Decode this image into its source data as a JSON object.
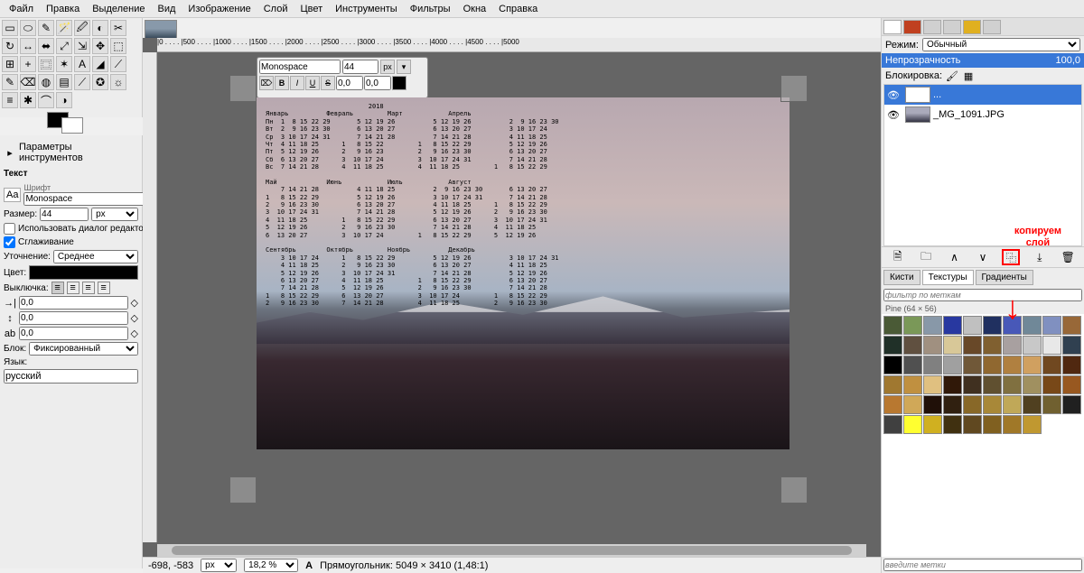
{
  "menu": [
    "Файл",
    "Правка",
    "Выделение",
    "Вид",
    "Изображение",
    "Слой",
    "Цвет",
    "Инструменты",
    "Фильтры",
    "Окна",
    "Справка"
  ],
  "tools": [
    "▭",
    "⬭",
    "✎",
    "🪄",
    "🖉",
    "◐",
    "✂",
    "↻",
    "↔",
    "⬌",
    "⤢",
    "⇲",
    "✥",
    "⬚",
    "⊞",
    "+",
    "⿴",
    "✶",
    "A",
    "◢",
    "⟋",
    "✎",
    "⌫",
    "◍",
    "▤",
    "⟋",
    "✪",
    "☼",
    "≡",
    "✱",
    "⌒",
    "◑"
  ],
  "tool_options": {
    "header": "Параметры инструментов",
    "section": "Текст",
    "font_label": "Шрифт",
    "font_value": "Monospace",
    "size_label": "Размер:",
    "size_value": "44",
    "size_unit": "px",
    "editor_dialog": "Использовать диалог редактора",
    "antialias": "Сглаживание",
    "hinting_label": "Уточнение:",
    "hinting_value": "Среднее",
    "color_label": "Цвет:",
    "justify_label": "Выключка:",
    "indent_value": "0,0",
    "line_value": "0,0",
    "letter_value": "0,0",
    "block_label": "Блок:",
    "block_value": "Фиксированный",
    "lang_label": "Язык:",
    "lang_value": "русский"
  },
  "text_toolbar": {
    "font": "Monospace",
    "size": "44",
    "unit": "px",
    "kern": "0,0",
    "baseline": "0,0"
  },
  "calendar_year": "2018",
  "cal_months": [
    {
      "name": "Январь",
      "rows": [
        "Пн  1  8 15 22 29",
        "Вт  2  9 16 23 30",
        "Ср  3 10 17 24 31",
        "Чт  4 11 18 25",
        "Пт  5 12 19 26",
        "Сб  6 13 20 27",
        "Вс  7 14 21 28"
      ]
    },
    {
      "name": "Февраль",
      "rows": [
        "    5 12 19 26",
        "    6 13 20 27",
        "    7 14 21 28",
        "1   8 15 22",
        "2   9 16 23",
        "3  10 17 24",
        "4  11 18 25"
      ]
    },
    {
      "name": "Март",
      "rows": [
        "    5 12 19 26",
        "    6 13 20 27",
        "    7 14 21 28",
        "1   8 15 22 29",
        "2   9 16 23 30",
        "3  10 17 24 31",
        "4  11 18 25"
      ]
    },
    {
      "name": "Апрель",
      "rows": [
        "    2  9 16 23 30",
        "    3 10 17 24",
        "    4 11 18 25",
        "    5 12 19 26",
        "    6 13 20 27",
        "    7 14 21 28",
        "1   8 15 22 29"
      ]
    },
    {
      "name": "Май",
      "rows": [
        "    7 14 21 28",
        "1   8 15 22 29",
        "2   9 16 23 30",
        "3  10 17 24 31",
        "4  11 18 25",
        "5  12 19 26",
        "6  13 20 27"
      ]
    },
    {
      "name": "Июнь",
      "rows": [
        "    4 11 18 25",
        "    5 12 19 26",
        "    6 13 20 27",
        "    7 14 21 28",
        "1   8 15 22 29",
        "2   9 16 23 30",
        "3  10 17 24"
      ]
    },
    {
      "name": "Июль",
      "rows": [
        "    2  9 16 23 30",
        "    3 10 17 24 31",
        "    4 11 18 25",
        "    5 12 19 26",
        "    6 13 20 27",
        "    7 14 21 28",
        "1   8 15 22 29"
      ]
    },
    {
      "name": "Август",
      "rows": [
        "    6 13 20 27",
        "    7 14 21 28",
        "1   8 15 22 29",
        "2   9 16 23 30",
        "3  10 17 24 31",
        "4  11 18 25",
        "5  12 19 26"
      ]
    },
    {
      "name": "Сентябрь",
      "rows": [
        "    3 10 17 24",
        "    4 11 18 25",
        "    5 12 19 26",
        "    6 13 20 27",
        "    7 14 21 28",
        "1   8 15 22 29",
        "2   9 16 23 30"
      ]
    },
    {
      "name": "Октябрь",
      "rows": [
        "1   8 15 22 29",
        "2   9 16 23 30",
        "3  10 17 24 31",
        "4  11 18 25",
        "5  12 19 26",
        "6  13 20 27",
        "7  14 21 28"
      ]
    },
    {
      "name": "Ноябрь",
      "rows": [
        "    5 12 19 26",
        "    6 13 20 27",
        "    7 14 21 28",
        "1   8 15 22 29",
        "2   9 16 23 30",
        "3  10 17 24",
        "4  11 18 25"
      ]
    },
    {
      "name": "Декабрь",
      "rows": [
        "    3 10 17 24 31",
        "    4 11 18 25",
        "    5 12 19 26",
        "    6 13 20 27",
        "    7 14 21 28",
        "1   8 15 22 29",
        "2   9 16 23 30"
      ]
    }
  ],
  "ruler_marks": "|0 . . . . |500 . . . . |1000 . . . . |1500 . . . . |2000 . . . . |2500 . . . . |3000 . . . . |3500 . . . . |4000 . . . . |4500 . . . . |5000",
  "status": {
    "coords": "-698, -583",
    "unit": "px",
    "zoom": "18,2 %",
    "info_icon": "A",
    "info": "Прямоугольник: 5049 × 3410 (1,48:1)"
  },
  "layers_panel": {
    "mode_label": "Режим:",
    "mode_value": "Обычный",
    "opacity_label": "Непрозрачность",
    "opacity_value": "100,0",
    "lock_label": "Блокировка:",
    "layers": [
      {
        "name": "...",
        "active": true,
        "thumb": "T"
      },
      {
        "name": "_MG_1091.JPG",
        "active": false,
        "thumb": "img"
      }
    ],
    "buttons": [
      "🗎",
      "🗀",
      "∧",
      "∨",
      "⿻",
      "⤓",
      "🗑"
    ]
  },
  "annotation": {
    "text1": "копируем",
    "text2": "слой",
    "arrow": "↓"
  },
  "brush_panel": {
    "tabs": [
      "Кисти",
      "Текстуры",
      "Градиенты"
    ],
    "active_tab": 1,
    "filter_placeholder": "фильтр по меткам",
    "selected_name": "Pine (64 × 56)",
    "textures_colors": [
      "#4a5a36",
      "#7a9858",
      "#8898a8",
      "#2838a0",
      "#c0c0c0",
      "#203060",
      "#4858b8",
      "#708898",
      "#8090c0",
      "#986838",
      "#203028",
      "#605040",
      "#a09080",
      "#d8c898",
      "#684828",
      "#806030",
      "#a8a0a0",
      "#c8c8c8",
      "#e8e8e8",
      "#304050",
      "#000000",
      "#505050",
      "#808080",
      "#a0a0a0",
      "#705838",
      "#906830",
      "#b08040",
      "#d0a060",
      "#704820",
      "#502810",
      "#a07830",
      "#c09040",
      "#e0c080",
      "#301808",
      "#403020",
      "#605030",
      "#807040",
      "#a09060",
      "#784818",
      "#985820",
      "#b87830",
      "#d0a858",
      "#201008",
      "#302010",
      "#886828",
      "#a88838",
      "#c0a858",
      "#504020",
      "#706030",
      "#202020",
      "#404040",
      "#ffff30",
      "#d0b020",
      "#403010",
      "#604820",
      "#806020",
      "#a07828",
      "#c09830"
    ],
    "tag_placeholder": "введите метки"
  }
}
